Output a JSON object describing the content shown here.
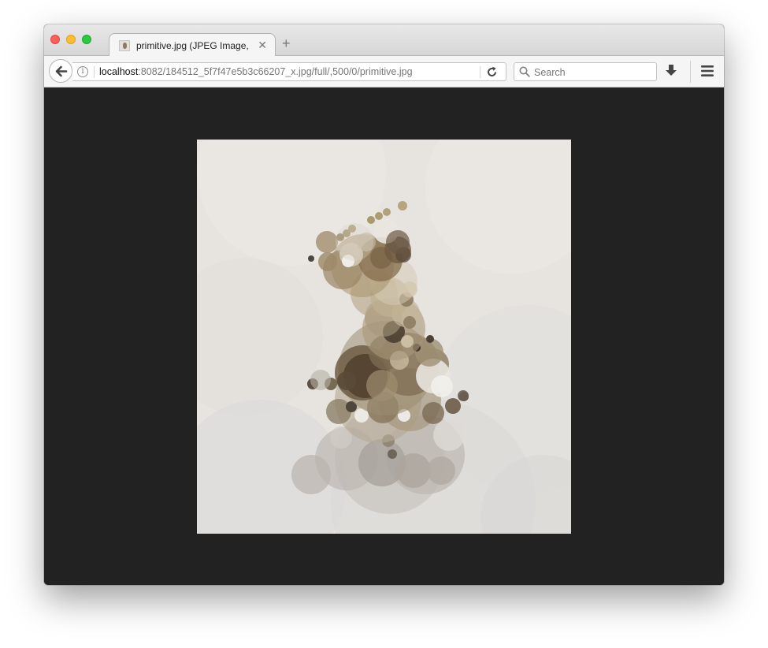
{
  "window": {
    "controls": [
      "close",
      "minimize",
      "maximize"
    ]
  },
  "tab": {
    "title": "primitive.jpg (JPEG Image, ...",
    "close_glyph": "✕",
    "favicon": "image-thumbnail-icon"
  },
  "new_tab_glyph": "+",
  "urlbar": {
    "host": "localhost",
    "path": ":8082/184512_5f7f47e5b3c66207_x.jpg/full/,500/0/primitive.jpg",
    "info_glyph": "i"
  },
  "search": {
    "placeholder": "Search"
  },
  "icons": {
    "back": "back-arrow-icon",
    "reload": "reload-icon",
    "download": "download-icon",
    "menu": "hamburger-menu-icon"
  },
  "colors": {
    "content_background": "#222222",
    "image_background": "#e7e4df"
  }
}
